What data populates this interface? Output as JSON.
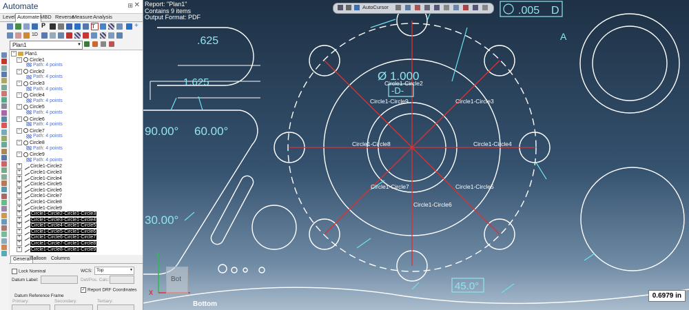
{
  "app": {
    "title": "Automate"
  },
  "ribbon_tabs": [
    "Levels",
    "Automate",
    "MBD",
    "Reverse",
    "Measure",
    "Analysis"
  ],
  "plan_selector": {
    "value": "Plan1"
  },
  "tree": {
    "root": "Plan1",
    "circles": [
      {
        "name": "Circle1",
        "path": "Path: 4 points"
      },
      {
        "name": "Circle2",
        "path": "Path: 4 points"
      },
      {
        "name": "Circle3",
        "path": "Path: 4 points"
      },
      {
        "name": "Circle4",
        "path": "Path: 4 points"
      },
      {
        "name": "Circle5",
        "path": "Path: 4 points"
      },
      {
        "name": "Circle6",
        "path": "Path: 4 points"
      },
      {
        "name": "Circle7",
        "path": "Path: 4 points"
      },
      {
        "name": "Circle8",
        "path": "Path: 4 points"
      },
      {
        "name": "Circle9",
        "path": "Path: 4 points"
      }
    ],
    "distances": [
      "Circle1-Circle2",
      "Circle1-Circle3",
      "Circle1-Circle4",
      "Circle1-Circle5",
      "Circle1-Circle6",
      "Circle1-Circle7",
      "Circle1-Circle8",
      "Circle1-Circle9"
    ],
    "selected_combos": [
      "Circle1-Circle2-Circle1-Circle3",
      "Circle1-Circle3-Circle1-Circle4",
      "Circle1-Circle4-Circle1-Circle5",
      "Circle1-Circle5-Circle1-Circle6",
      "Circle1-Circle6-Circle1-Circle7",
      "Circle1-Circle7-Circle1-Circle8",
      "Circle1-Circle8-Circle1-Circle9"
    ]
  },
  "properties": {
    "tabs": [
      "General",
      "Balloon",
      "Columns"
    ],
    "lock_nominal": "Lock Nominal",
    "wcs_label": "WCS:",
    "wcs_value": "Top",
    "datum_label": "Datum Label:",
    "det_pos_calc": "Det/Pos. Calc:",
    "report_drf": "Report DRF Coordinates",
    "drf_title": "Datum Reference Frame",
    "primary": "Primary:",
    "secondary": "Secondary:",
    "tertiary": "Tertiary:"
  },
  "viewport": {
    "report_lines": [
      "Report: \"Plan1\"",
      "Contains 9 items",
      "Output Format: PDF"
    ],
    "autocursor": "AutoCursor",
    "view_name": "Bottom",
    "navcube_face": "Bot",
    "readout": "0.6979 in",
    "distance_labels": [
      "Circle1-Circle2",
      "Circle1-Circle3",
      "Circle1-Circle4",
      "Circle1-Circle5",
      "Circle1-Circle6",
      "Circle1-Circle7",
      "Circle1-Circle8",
      "Circle1-Circle9"
    ],
    "dims": {
      "d625": ".625",
      "d1625": "1.625",
      "a90": "90.00°",
      "a60": "60.00°",
      "a30": "30.00°",
      "a45": "45.0°",
      "diameter": "Ø 1.000",
      "datum_d": "-D-",
      "fcf_value": ".005",
      "fcf_datum": "D",
      "datum_a": "A"
    }
  },
  "colors": {
    "red_line": "#e03030",
    "cyan": "#6fe3ef",
    "white": "#ffffff"
  }
}
